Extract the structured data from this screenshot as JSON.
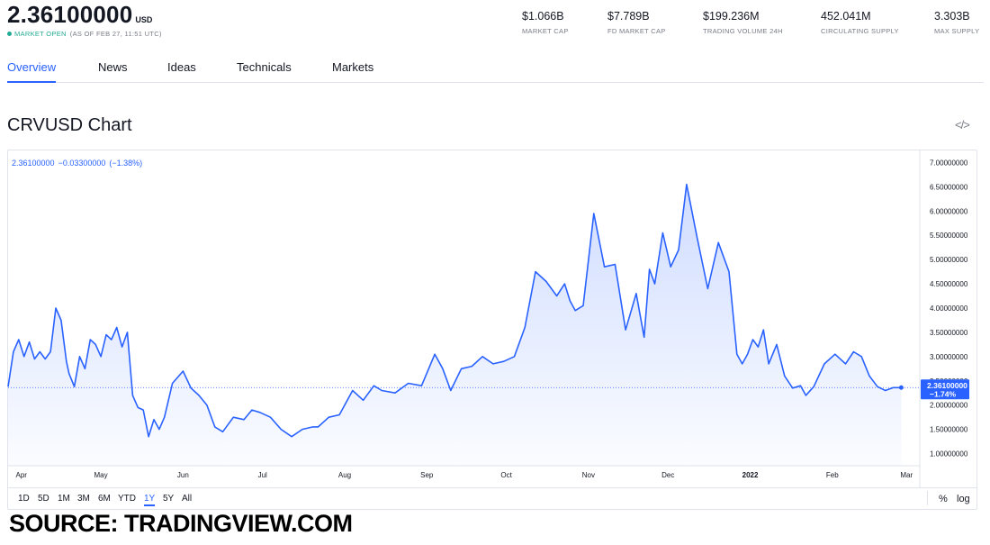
{
  "header": {
    "price": "2.36100000",
    "currency": "USD",
    "market_status": "MARKET OPEN",
    "as_of": "(AS OF FEB 27, 11:51 UTC)",
    "stats": [
      {
        "value": "$1.066B",
        "label": "MARKET CAP"
      },
      {
        "value": "$7.789B",
        "label": "FD MARKET CAP"
      },
      {
        "value": "$199.236M",
        "label": "TRADING VOLUME 24H"
      },
      {
        "value": "452.041M",
        "label": "CIRCULATING SUPPLY"
      },
      {
        "value": "3.303B",
        "label": "MAX SUPPLY"
      }
    ]
  },
  "tabs": [
    "Overview",
    "News",
    "Ideas",
    "Technicals",
    "Markets"
  ],
  "active_tab": "Overview",
  "chart_title": "CRVUSD Chart",
  "embed_icon": "code-embed-icon",
  "legend": {
    "last": "2.36100000",
    "change": "−0.03300000",
    "change_pct": "(−1.38%)"
  },
  "price_tag": {
    "value": "2.36100000",
    "change": "−1.74%"
  },
  "ranges": [
    "1D",
    "5D",
    "1M",
    "3M",
    "6M",
    "YTD",
    "1Y",
    "5Y",
    "All"
  ],
  "active_range": "1Y",
  "scale_buttons": {
    "percent": "%",
    "log": "log"
  },
  "source": "SOURCE: TRADINGVIEW.COM",
  "colors": {
    "line": "#2962ff",
    "accent": "#2962ff",
    "green": "#22ab94"
  },
  "chart_data": {
    "type": "area",
    "title": "CRVUSD Chart",
    "xlabel": "",
    "ylabel": "",
    "x_ticks": [
      "Apr",
      "May",
      "Jun",
      "Jul",
      "Aug",
      "Sep",
      "Oct",
      "Nov",
      "Dec",
      "2022",
      "Feb",
      "Mar"
    ],
    "y_ticks": [
      "1.00000000",
      "1.50000000",
      "2.00000000",
      "2.50000000",
      "3.00000000",
      "3.50000000",
      "4.00000000",
      "4.50000000",
      "5.00000000",
      "5.50000000",
      "6.00000000",
      "6.50000000",
      "7.00000000"
    ],
    "ylim": [
      0.75,
      7.25
    ],
    "xlim": [
      "2021-03-27",
      "2022-03-06"
    ],
    "grid": false,
    "current_value": 2.361,
    "series": [
      {
        "x": [
          "2021-03-27",
          "2021-03-29",
          "2021-03-31",
          "2021-04-02",
          "2021-04-04",
          "2021-04-06",
          "2021-04-08",
          "2021-04-10",
          "2021-04-12",
          "2021-04-14",
          "2021-04-16",
          "2021-04-18",
          "2021-04-19",
          "2021-04-21",
          "2021-04-23",
          "2021-04-25",
          "2021-04-27",
          "2021-04-29",
          "2021-05-01",
          "2021-05-03",
          "2021-05-05",
          "2021-05-07",
          "2021-05-09",
          "2021-05-11",
          "2021-05-13",
          "2021-05-15",
          "2021-05-17",
          "2021-05-19",
          "2021-05-21",
          "2021-05-23",
          "2021-05-25",
          "2021-05-28",
          "2021-06-01",
          "2021-06-04",
          "2021-06-07",
          "2021-06-10",
          "2021-06-13",
          "2021-06-16",
          "2021-06-20",
          "2021-06-24",
          "2021-06-27",
          "2021-06-30",
          "2021-07-04",
          "2021-07-08",
          "2021-07-12",
          "2021-07-16",
          "2021-07-20",
          "2021-07-22",
          "2021-07-26",
          "2021-07-30",
          "2021-08-04",
          "2021-08-08",
          "2021-08-12",
          "2021-08-15",
          "2021-08-20",
          "2021-08-25",
          "2021-08-30",
          "2021-09-04",
          "2021-09-07",
          "2021-09-10",
          "2021-09-14",
          "2021-09-18",
          "2021-09-22",
          "2021-09-26",
          "2021-09-30",
          "2021-10-04",
          "2021-10-08",
          "2021-10-12",
          "2021-10-16",
          "2021-10-20",
          "2021-10-23",
          "2021-10-25",
          "2021-10-27",
          "2021-10-30",
          "2021-11-03",
          "2021-11-07",
          "2021-11-11",
          "2021-11-15",
          "2021-11-19",
          "2021-11-22",
          "2021-11-24",
          "2021-11-26",
          "2021-11-29",
          "2021-12-02",
          "2021-12-05",
          "2021-12-08",
          "2021-12-12",
          "2021-12-16",
          "2021-12-20",
          "2021-12-24",
          "2021-12-27",
          "2021-12-29",
          "2021-12-31",
          "2022-01-02",
          "2022-01-04",
          "2022-01-06",
          "2022-01-08",
          "2022-01-11",
          "2022-01-14",
          "2022-01-17",
          "2022-01-20",
          "2022-01-22",
          "2022-01-25",
          "2022-01-29",
          "2022-02-02",
          "2022-02-06",
          "2022-02-09",
          "2022-02-12",
          "2022-02-15",
          "2022-02-18",
          "2022-02-21",
          "2022-02-24",
          "2022-02-27"
        ],
        "y": [
          2.38,
          3.1,
          3.35,
          3.0,
          3.3,
          2.95,
          3.1,
          2.95,
          3.1,
          4.0,
          3.75,
          2.9,
          2.65,
          2.38,
          3.0,
          2.75,
          3.35,
          3.25,
          3.0,
          3.45,
          3.35,
          3.6,
          3.2,
          3.5,
          2.2,
          1.95,
          1.9,
          1.35,
          1.7,
          1.5,
          1.75,
          2.45,
          2.7,
          2.35,
          2.2,
          2.0,
          1.55,
          1.45,
          1.75,
          1.7,
          1.9,
          1.85,
          1.75,
          1.5,
          1.35,
          1.5,
          1.55,
          1.55,
          1.75,
          1.8,
          2.3,
          2.1,
          2.4,
          2.3,
          2.25,
          2.45,
          2.4,
          3.05,
          2.75,
          2.3,
          2.75,
          2.8,
          3.0,
          2.85,
          2.9,
          3.0,
          3.6,
          4.75,
          4.55,
          4.25,
          4.5,
          4.15,
          3.95,
          4.05,
          5.95,
          4.85,
          4.9,
          3.55,
          4.3,
          3.4,
          4.8,
          4.5,
          5.55,
          4.85,
          5.2,
          6.55,
          5.45,
          4.4,
          5.35,
          4.75,
          3.05,
          2.85,
          3.05,
          3.35,
          3.2,
          3.55,
          2.85,
          3.25,
          2.6,
          2.35,
          2.4,
          2.2,
          2.38,
          2.85,
          3.05,
          2.85,
          3.1,
          3.0,
          2.6,
          2.38,
          2.3,
          2.36,
          2.361
        ]
      }
    ]
  }
}
